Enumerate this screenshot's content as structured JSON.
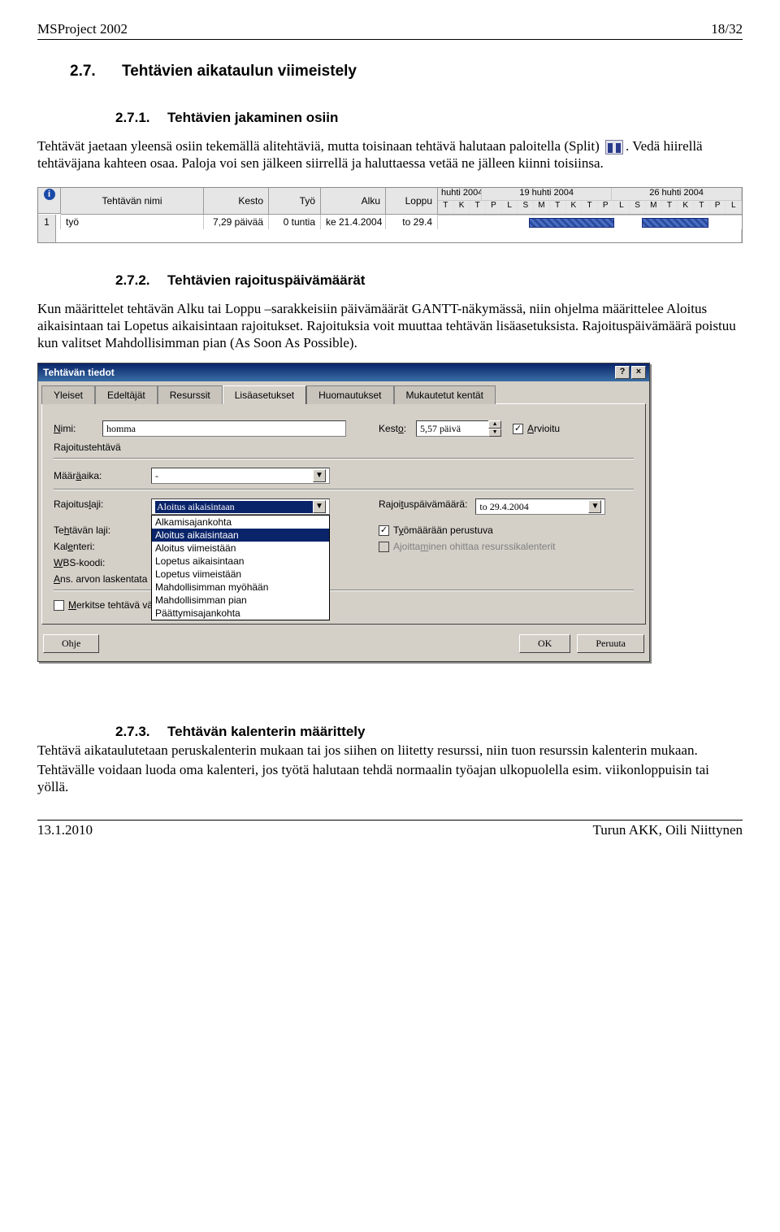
{
  "header": {
    "left": "MSProject 2002",
    "right": "18/32"
  },
  "footer": {
    "left": "13.1.2010",
    "right": "Turun AKK, Oili Niittynen"
  },
  "sec27": {
    "num": "2.7.",
    "title": "Tehtävien aikataulun viimeistely"
  },
  "sec271": {
    "num": "2.7.1.",
    "title": "Tehtävien jakaminen osiin"
  },
  "sec272": {
    "num": "2.7.2.",
    "title": "Tehtävien rajoituspäivämäärät"
  },
  "sec273": {
    "num": "2.7.3.",
    "title": "Tehtävän kalenterin määrittely"
  },
  "p271a_before": "Tehtävät jaetaan yleensä osiin tekemällä alitehtäviä, mutta toisinaan tehtävä halutaan paloitella (Split)",
  "p271a_after": ". Vedä hiirellä tehtäväjana kahteen osaa. Paloja voi sen jälkeen siirrellä ja haluttaessa vetää ne jälleen kiinni toisiinsa.",
  "p272a": "Kun määrittelet tehtävän Alku tai Loppu –sarakkeisiin päivämäärät GANTT-näkymässä, niin ohjelma määrittelee Aloitus aikaisintaan  tai Lopetus aikaisintaan rajoitukset. Rajoituksia voit muuttaa tehtävän lisäasetuksista. Rajoituspäivämäärä poistuu kun valitset Mahdollisimman pian (As Soon As Possible).",
  "p273a": "Tehtävä aikataulutetaan peruskalenterin mukaan tai jos siihen on liitetty resurssi, niin tuon resurssin kalenterin mukaan.",
  "p273b": "Tehtävälle voidaan luoda oma kalenteri, jos työtä halutaan tehdä normaalin työajan ulkopuolella esim. viikonloppuisin tai yöllä.",
  "gantt": {
    "cols": {
      "name": "Tehtävän nimi",
      "kesto": "Kesto",
      "tyo": "Työ",
      "alku": "Alku",
      "loppu": "Loppu"
    },
    "timeline": {
      "segments": [
        "huhti 2004",
        "19 huhti 2004",
        "26 huhti 2004"
      ],
      "days": [
        "T",
        "K",
        "T",
        "P",
        "L",
        "S",
        "M",
        "T",
        "K",
        "T",
        "P",
        "L",
        "S",
        "M",
        "T",
        "K",
        "T",
        "P",
        "L"
      ]
    },
    "row": {
      "idx": "1",
      "name": "työ",
      "kesto": "7,29 päivää",
      "tyo": "0 tuntia",
      "alku": "ke 21.4.2004",
      "loppu": "to 29.4"
    }
  },
  "dialog": {
    "title": "Tehtävän tiedot",
    "help_btn": "?",
    "close_btn": "×",
    "tabs": [
      "Yleiset",
      "Edeltäjät",
      "Resurssit",
      "Lisäasetukset",
      "Huomautukset",
      "Mukautetut kentät"
    ],
    "active_tab": 3,
    "nimi_label": "Nimi:",
    "nimi_value": "homma",
    "kesto_label": "Kesto:",
    "kesto_value": "5,57 päivä",
    "arvioitu_label": "Arvioitu",
    "arvioitu_checked": true,
    "group_label": "Rajoitustehtävä",
    "maaraaika_label": "Määräaika:",
    "maaraaika_value": "-",
    "rajoituslaji_label": "Rajoituslaji:",
    "rajoituslaji_value": "Aloitus aikaisintaan",
    "rajoituslaji_options": [
      "Alkamisajankohta",
      "Aloitus aikaisintaan",
      "Aloitus viimeistään",
      "Lopetus aikaisintaan",
      "Lopetus viimeistään",
      "Mahdollisimman myöhään",
      "Mahdollisimman pian",
      "Päättymisajankohta"
    ],
    "rajoituspvm_label": "Rajoituspäivämäärä:",
    "rajoituspvm_value": "to 29.4.2004",
    "tehtlaji_label": "Tehtävän laji:",
    "tyomaaraan_label": "Työmäärään perustuva",
    "tyomaaraan_checked": true,
    "kalenteri_label": "Kalenteri:",
    "ajoittaminen_label": "Ajoittaminen ohittaa resurssikalenterit",
    "wbs_label": "WBS-koodi:",
    "ans_label": "Ans. arvon laskentata",
    "merkitse_label": "Merkitse tehtävä välitavoitteeksi",
    "ohje": "Ohje",
    "ok": "OK",
    "peruuta": "Peruuta"
  }
}
